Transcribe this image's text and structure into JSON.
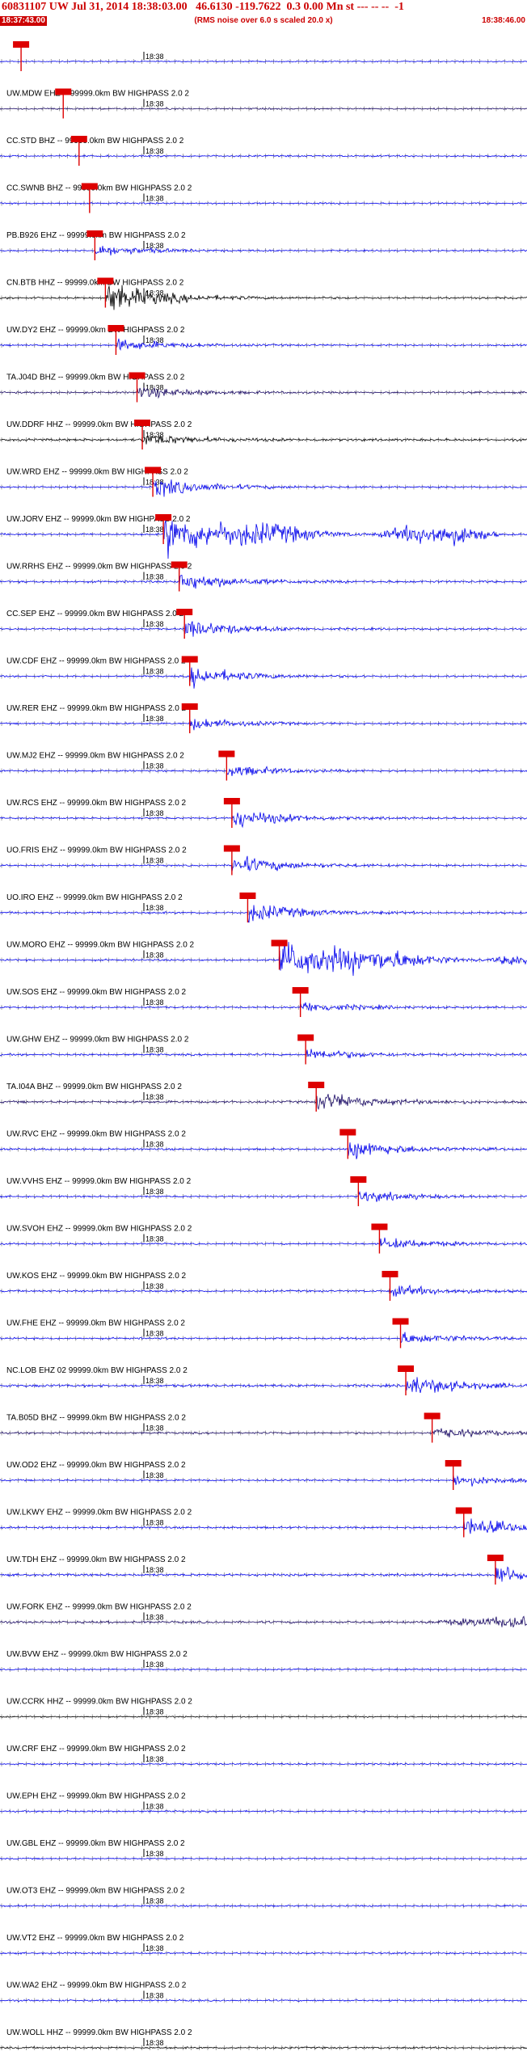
{
  "header": {
    "title": "60831107 UW Jul 31, 2014 18:38:03.00   46.6130 -119.7622  0.3 0.00 Mn st --- -- --  -1",
    "subtitle": "(RMS noise over 6.0 s scaled 20.0 x)",
    "time_start": "18:37:43.00",
    "time_end": "18:38:46.00"
  },
  "minute_label": "18:38",
  "colors": {
    "header_red": "#cc0000",
    "pick_red": "#dd0000",
    "trace_blue": "#0000ee",
    "trace_black": "#000000",
    "trace_navy": "#1a0a66",
    "label_text": "#000000"
  },
  "traces": [
    {
      "label": "",
      "color": "blue",
      "pick": 0.04,
      "event": "none",
      "noise": 0.25
    },
    {
      "label": "UW.MDW EHZ -- 99999.0km BW  HIGHPASS  2.0  2",
      "color": "navy",
      "pick": 0.12,
      "event": "none",
      "noise": 0.35
    },
    {
      "label": "CC.STD BHZ -- 99999.0km BW  HIGHPASS  2.0  2",
      "color": "blue",
      "pick": 0.15,
      "event": "none",
      "noise": 0.35
    },
    {
      "label": "CC.SWNB BHZ -- 99999.0km BW  HIGHPASS  2.0  2",
      "color": "blue",
      "pick": 0.17,
      "event": "none",
      "noise": 0.35
    },
    {
      "label": "PB.B926 EHZ -- 99999.0km BW  HIGHPASS  2.0  2",
      "color": "blue",
      "pick": 0.18,
      "event": "small",
      "noise": 0.3
    },
    {
      "label": "CN.BTB HHZ -- 99999.0km BW  HIGHPASS  2.0  2",
      "color": "black",
      "pick": 0.2,
      "event": "big",
      "noise": 0.4
    },
    {
      "label": "UW.DY2 EHZ -- 99999.0km BW  HIGHPASS  2.0  2",
      "color": "blue",
      "pick": 0.22,
      "event": "small",
      "noise": 0.35
    },
    {
      "label": "TA.J04D BHZ -- 99999.0km BW  HIGHPASS  2.0  2",
      "color": "navy",
      "pick": 0.26,
      "event": "small",
      "noise": 0.4
    },
    {
      "label": "UW.DDRF HHZ -- 99999.0km BW  HIGHPASS  2.0  2",
      "color": "black",
      "pick": 0.27,
      "event": "small",
      "noise": 0.5
    },
    {
      "label": "UW.WRD EHZ -- 99999.0km BW  HIGHPASS  2.0  2",
      "color": "blue",
      "pick": 0.29,
      "event": "medium",
      "noise": 0.35
    },
    {
      "label": "UW.JORV EHZ -- 99999.0km BW  HIGHPASS  2.0  2",
      "color": "blue",
      "pick": 0.31,
      "event": "huge",
      "noise": 0.4
    },
    {
      "label": "UW.RRHS EHZ -- 99999.0km BW  HIGHPASS  2.0  2",
      "color": "blue",
      "pick": 0.34,
      "event": "medium",
      "noise": 0.45
    },
    {
      "label": "CC.SEP EHZ -- 99999.0km BW  HIGHPASS  2.0  2",
      "color": "blue",
      "pick": 0.35,
      "event": "medium",
      "noise": 0.35
    },
    {
      "label": "UW.CDF EHZ -- 99999.0km BW  HIGHPASS  2.0  2",
      "color": "blue",
      "pick": 0.36,
      "event": "medium",
      "noise": 0.35
    },
    {
      "label": "UW.RER EHZ -- 99999.0km BW  HIGHPASS  2.0  2",
      "color": "blue",
      "pick": 0.36,
      "event": "small",
      "noise": 0.35
    },
    {
      "label": "UW.MJ2 EHZ -- 99999.0km BW  HIGHPASS  2.0  2",
      "color": "blue",
      "pick": 0.43,
      "event": "small",
      "noise": 0.35
    },
    {
      "label": "UW.RCS EHZ -- 99999.0km BW  HIGHPASS  2.0  2",
      "color": "blue",
      "pick": 0.44,
      "event": "medium",
      "noise": 0.35
    },
    {
      "label": "UO.FRIS EHZ -- 99999.0km BW  HIGHPASS  2.0  2",
      "color": "blue",
      "pick": 0.44,
      "event": "medium",
      "noise": 0.35
    },
    {
      "label": "UO.IRO EHZ -- 99999.0km BW  HIGHPASS  2.0  2",
      "color": "blue",
      "pick": 0.47,
      "event": "medium",
      "noise": 0.4
    },
    {
      "label": "UW.MORO EHZ -- 99999.0km BW  HIGHPASS  2.0  2",
      "color": "blue",
      "pick": 0.53,
      "event": "huge",
      "noise": 0.4
    },
    {
      "label": "UW.SOS EHZ -- 99999.0km BW  HIGHPASS  2.0  2",
      "color": "blue",
      "pick": 0.57,
      "event": "small",
      "noise": 0.35
    },
    {
      "label": "UW.GHW EHZ -- 99999.0km BW  HIGHPASS  2.0  2",
      "color": "blue",
      "pick": 0.58,
      "event": "small",
      "noise": 0.4
    },
    {
      "label": "TA.I04A BHZ -- 99999.0km BW  HIGHPASS  2.0  2",
      "color": "navy",
      "pick": 0.6,
      "event": "medium",
      "noise": 0.5
    },
    {
      "label": "UW.RVC EHZ -- 99999.0km BW  HIGHPASS  2.0  2",
      "color": "blue",
      "pick": 0.66,
      "event": "medium",
      "noise": 0.4
    },
    {
      "label": "UW.VVHS EHZ -- 99999.0km BW  HIGHPASS  2.0  2",
      "color": "blue",
      "pick": 0.68,
      "event": "small",
      "noise": 0.35
    },
    {
      "label": "UW.SVOH EHZ -- 99999.0km BW  HIGHPASS  2.0  2",
      "color": "blue",
      "pick": 0.72,
      "event": "small",
      "noise": 0.35
    },
    {
      "label": "UW.KOS EHZ -- 99999.0km BW  HIGHPASS  2.0  2",
      "color": "blue",
      "pick": 0.74,
      "event": "small",
      "noise": 0.4
    },
    {
      "label": "UW.FHE EHZ -- 99999.0km BW  HIGHPASS  2.0  2",
      "color": "blue",
      "pick": 0.76,
      "event": "small",
      "noise": 0.4
    },
    {
      "label": "NC.LOB EHZ 02 99999.0km BW  HIGHPASS  2.0  2",
      "color": "blue",
      "pick": 0.77,
      "event": "medium",
      "noise": 0.55
    },
    {
      "label": "TA.B05D BHZ -- 99999.0km BW  HIGHPASS  2.0  2",
      "color": "navy",
      "pick": 0.82,
      "event": "small",
      "noise": 0.4
    },
    {
      "label": "UW.OD2 EHZ -- 99999.0km BW  HIGHPASS  2.0  2",
      "color": "blue",
      "pick": 0.86,
      "event": "small",
      "noise": 0.35
    },
    {
      "label": "UW.LKWY EHZ -- 99999.0km BW  HIGHPASS  2.0  2",
      "color": "blue",
      "pick": 0.88,
      "event": "medium",
      "noise": 0.4
    },
    {
      "label": "UW.TDH EHZ -- 99999.0km BW  HIGHPASS  2.0  2",
      "color": "blue",
      "pick": 0.94,
      "event": "medium",
      "noise": 0.5
    },
    {
      "label": "UW.FORK EHZ -- 99999.0km BW  HIGHPASS  2.0  2",
      "color": "navy",
      "pick": null,
      "event": "end",
      "noise": 0.5
    },
    {
      "label": "UW.BVW EHZ -- 99999.0km BW  HIGHPASS  2.0  2",
      "color": "blue",
      "pick": null,
      "event": "none",
      "noise": 0.3
    },
    {
      "label": "UW.CCRK HHZ -- 99999.0km BW  HIGHPASS  2.0  2",
      "color": "black",
      "pick": null,
      "event": "none",
      "noise": 0.3
    },
    {
      "label": "UW.CRF EHZ -- 99999.0km BW  HIGHPASS  2.0  2",
      "color": "blue",
      "pick": null,
      "event": "none",
      "noise": 0.35
    },
    {
      "label": "UW.EPH EHZ -- 99999.0km BW  HIGHPASS  2.0  2",
      "color": "blue",
      "pick": null,
      "event": "none",
      "noise": 0.35
    },
    {
      "label": "UW.GBL EHZ -- 99999.0km BW  HIGHPASS  2.0  2",
      "color": "blue",
      "pick": null,
      "event": "none",
      "noise": 0.3
    },
    {
      "label": "UW.OT3 EHZ -- 99999.0km BW  HIGHPASS  2.0  2",
      "color": "blue",
      "pick": null,
      "event": "none",
      "noise": 0.35
    },
    {
      "label": "UW.VT2 EHZ -- 99999.0km BW  HIGHPASS  2.0  2",
      "color": "blue",
      "pick": null,
      "event": "none",
      "noise": 0.35
    },
    {
      "label": "UW.WA2 EHZ -- 99999.0km BW  HIGHPASS  2.0  2",
      "color": "blue",
      "pick": null,
      "event": "none",
      "noise": 0.35
    },
    {
      "label": "UW.WOLL HHZ -- 99999.0km BW  HIGHPASS  2.0  2",
      "color": "black",
      "pick": null,
      "event": "none",
      "noise": 0.4
    }
  ]
}
